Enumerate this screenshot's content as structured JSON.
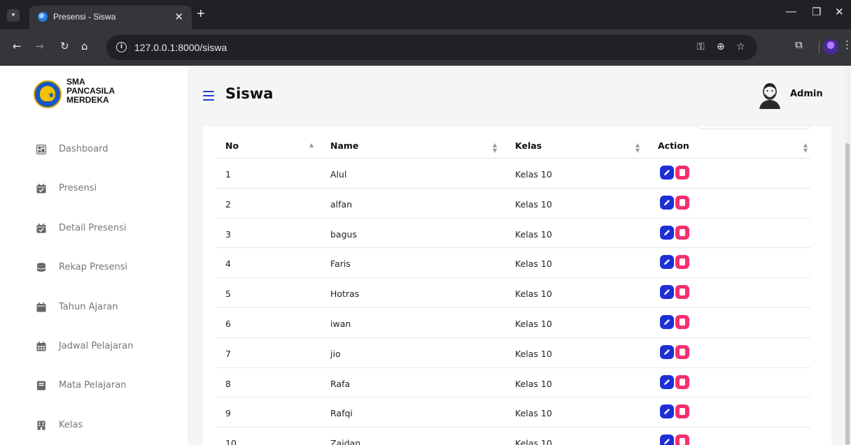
{
  "browser": {
    "tab_title": "Presensi - Siswa",
    "url": "127.0.0.1:8000/siswa"
  },
  "sidebar": {
    "school_name": "SMA\nPANCASILA\nMERDEKA",
    "items": [
      {
        "label": "Dashboard",
        "icon": "dashboard-icon"
      },
      {
        "label": "Presensi",
        "icon": "calendar-check-icon"
      },
      {
        "label": "Detail Presensi",
        "icon": "calendar-check-icon"
      },
      {
        "label": "Rekap Presensi",
        "icon": "database-icon"
      },
      {
        "label": "Tahun Ajaran",
        "icon": "calendar-icon"
      },
      {
        "label": "Jadwal Pelajaran",
        "icon": "calendar-grid-icon"
      },
      {
        "label": "Mata Pelajaran",
        "icon": "book-icon"
      },
      {
        "label": "Kelas",
        "icon": "building-icon"
      }
    ]
  },
  "header": {
    "title": "Siswa",
    "user_name": "Admin"
  },
  "table": {
    "columns": [
      "No",
      "Name",
      "Kelas",
      "Action"
    ],
    "rows": [
      {
        "no": "1",
        "name": "Alul",
        "kelas": "Kelas 10"
      },
      {
        "no": "2",
        "name": "alfan",
        "kelas": "Kelas 10"
      },
      {
        "no": "3",
        "name": "bagus",
        "kelas": "Kelas 10"
      },
      {
        "no": "4",
        "name": "Faris",
        "kelas": "Kelas 10"
      },
      {
        "no": "5",
        "name": "Hotras",
        "kelas": "Kelas 10"
      },
      {
        "no": "6",
        "name": "iwan",
        "kelas": "Kelas 10"
      },
      {
        "no": "7",
        "name": "jio",
        "kelas": "Kelas 10"
      },
      {
        "no": "8",
        "name": "Rafa",
        "kelas": "Kelas 10"
      },
      {
        "no": "9",
        "name": "Rafqi",
        "kelas": "Kelas 10"
      },
      {
        "no": "10",
        "name": "Zaidan",
        "kelas": "Kelas 10"
      }
    ]
  },
  "colors": {
    "accent": "#1e3fd8",
    "edit_button": "#1f2fd6",
    "delete_button": "#f5306e"
  }
}
